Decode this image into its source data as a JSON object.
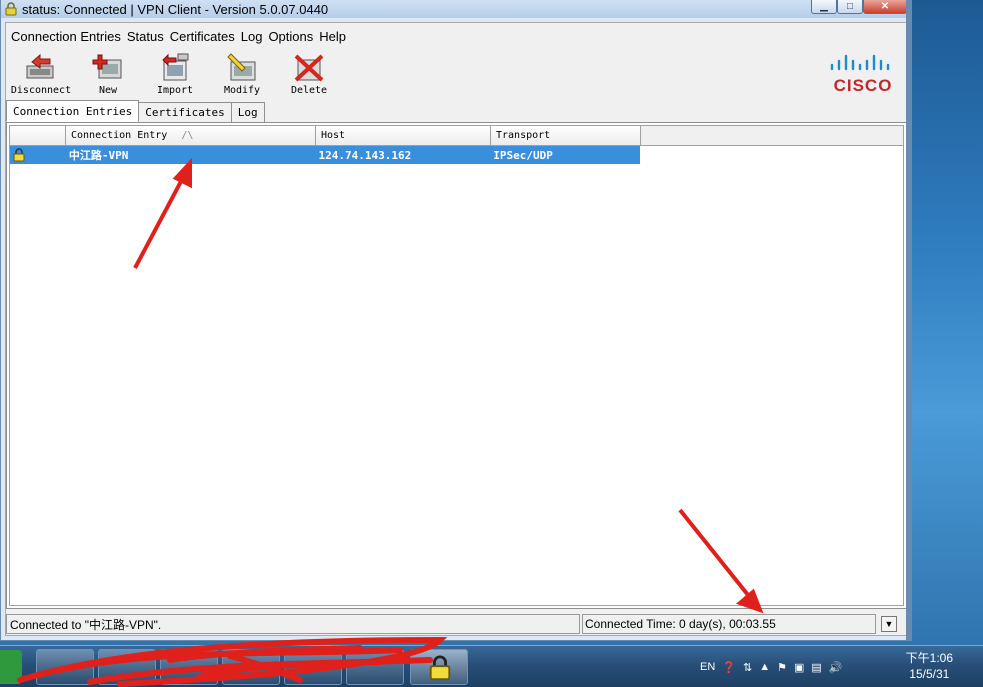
{
  "window": {
    "title": "status: Connected | VPN Client - Version 5.0.07.0440"
  },
  "menu": [
    "Connection Entries",
    "Status",
    "Certificates",
    "Log",
    "Options",
    "Help"
  ],
  "toolbar": {
    "disconnect": "Disconnect",
    "new": "New",
    "import": "Import",
    "modify": "Modify",
    "delete": "Delete"
  },
  "brand": {
    "logo_text": "CISCO",
    "color": "#c1272d"
  },
  "tabs": [
    "Connection Entries",
    "Certificates",
    "Log"
  ],
  "table": {
    "columns": [
      "Connection Entry",
      "Host",
      "Transport"
    ],
    "sort_indicator": "/\\",
    "rows": [
      {
        "entry": "中江路-VPN",
        "host": "124.74.143.162",
        "transport": "IPSec/UDP",
        "selected": true
      }
    ]
  },
  "status": {
    "left": "Connected to \"中江路-VPN\".",
    "right": "Connected Time: 0 day(s), 00:03.55"
  },
  "taskbar": {
    "lang": "EN",
    "clock_time": "下午1:06",
    "clock_date": "15/5/31"
  },
  "colors": {
    "selection": "#3a8fdc",
    "annotation_arrow": "#e0201b"
  }
}
